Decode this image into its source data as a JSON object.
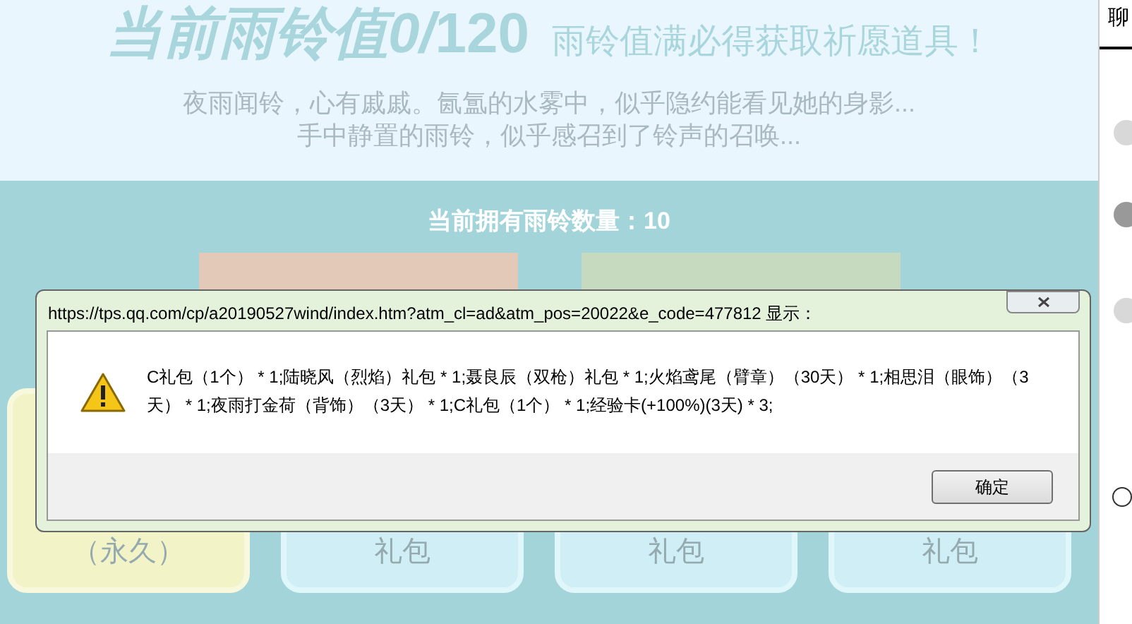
{
  "header": {
    "value_label": "当前雨铃值0/",
    "value_max": "120",
    "promise": "雨铃值满必得获取祈愿道具！",
    "story": [
      "夜雨闻铃，心有戚戚。氤氲的水雾中，似乎隐约能看见她的身影...",
      "手中静置的雨铃，似乎感召到了铃声的召唤..."
    ]
  },
  "count_label": "当前拥有雨铃数量：10",
  "cards": [
    {
      "label": "（永久）",
      "kind": "yellow"
    },
    {
      "label": "礼包",
      "kind": "blue"
    },
    {
      "label": "礼包",
      "kind": "blue"
    },
    {
      "label": "礼包",
      "kind": "blue"
    }
  ],
  "sidebar": {
    "title": "聊"
  },
  "dialog": {
    "title": "https://tps.qq.com/cp/a20190527wind/index.htm?atm_cl=ad&atm_pos=20022&e_code=477812 显示：",
    "message": "C礼包（1个） * 1;陆晓风（烈焰）礼包 * 1;聂良辰（双枪）礼包 * 1;火焰鸢尾（臂章）（30天） * 1;相思泪（眼饰）（3天） * 1;夜雨打金荷（背饰）（3天） * 1;C礼包（1个） * 1;经验卡(+100%)(3天) * 3;",
    "ok": "确定"
  }
}
